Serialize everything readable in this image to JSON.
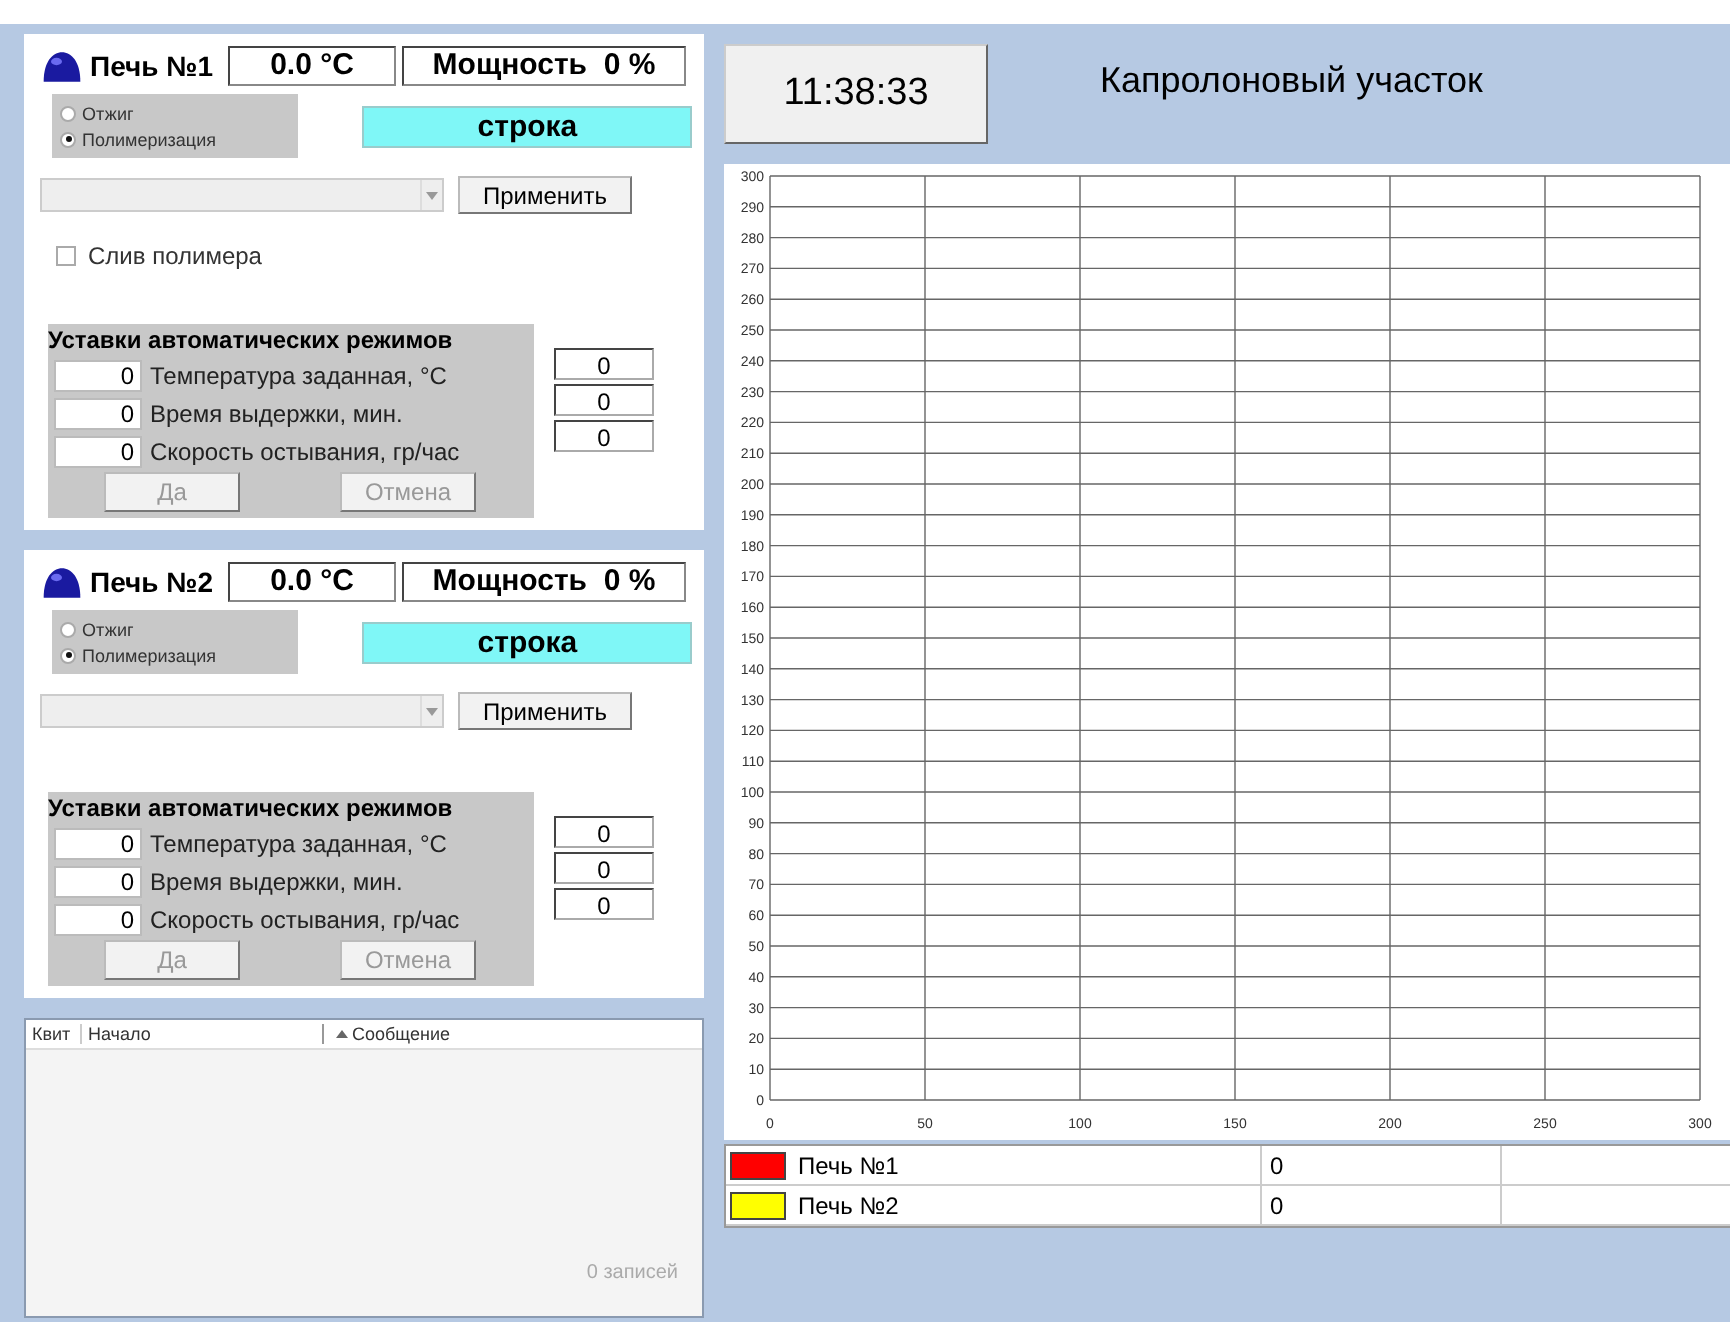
{
  "furnaces": [
    {
      "name": "Печь №1",
      "temperature": "0.0 °C",
      "power": "Мощность  0 %",
      "modes": [
        {
          "label": "Отжиг",
          "selected": false
        },
        {
          "label": "Полимеризация",
          "selected": true
        }
      ],
      "status": "строка",
      "apply_button": "Применить",
      "drain": {
        "label": "Слив полимера",
        "checked": false
      },
      "settings": {
        "title": "Уставки автоматических режимов",
        "rows": [
          {
            "setpoint": "0",
            "label": "Температура заданная, °C",
            "current": "0"
          },
          {
            "setpoint": "0",
            "label": "Время выдержки, мин.",
            "current": "0"
          },
          {
            "setpoint": "0",
            "label": "Скорость остывания, гр/час",
            "current": "0"
          }
        ],
        "buttons": [
          {
            "label": "Да",
            "disabled": true
          },
          {
            "label": "Отмена",
            "disabled": true
          }
        ]
      }
    },
    {
      "name": "Печь №2",
      "temperature": "0.0 °C",
      "power": "Мощность  0 %",
      "modes": [
        {
          "label": "Отжиг",
          "selected": false
        },
        {
          "label": "Полимеризация",
          "selected": true
        }
      ],
      "status": "строка",
      "apply_button": "Применить",
      "settings": {
        "title": "Уставки автоматических режимов",
        "rows": [
          {
            "setpoint": "0",
            "label": "Температура заданная, °C",
            "current": "0"
          },
          {
            "setpoint": "0",
            "label": "Время выдержки, мин.",
            "current": "0"
          },
          {
            "setpoint": "0",
            "label": "Скорость остывания, гр/час",
            "current": "0"
          }
        ],
        "buttons": [
          {
            "label": "Да",
            "disabled": true
          },
          {
            "label": "Отмена",
            "disabled": true
          }
        ]
      }
    }
  ],
  "log": {
    "columns": [
      "Квит",
      "Начало",
      "Сообщение"
    ],
    "footer": "0 записей"
  },
  "clock": "11:38:33",
  "title": "Капролоновый участок",
  "chart_data": {
    "type": "line",
    "grid": true,
    "xlim": [
      0,
      300
    ],
    "ylim": [
      0,
      300
    ],
    "xticks": [
      0,
      50,
      100,
      150,
      200,
      250,
      300
    ],
    "yticks": [
      0,
      10,
      20,
      30,
      40,
      50,
      60,
      70,
      80,
      90,
      100,
      110,
      120,
      130,
      140,
      150,
      160,
      170,
      180,
      190,
      200,
      210,
      220,
      230,
      240,
      250,
      260,
      270,
      280,
      290,
      300
    ]
  },
  "legend": [
    {
      "name": "Печь №1",
      "color": "#ff0000",
      "value": "0"
    },
    {
      "name": "Печь №2",
      "color": "#ffff00",
      "value": "0"
    }
  ]
}
